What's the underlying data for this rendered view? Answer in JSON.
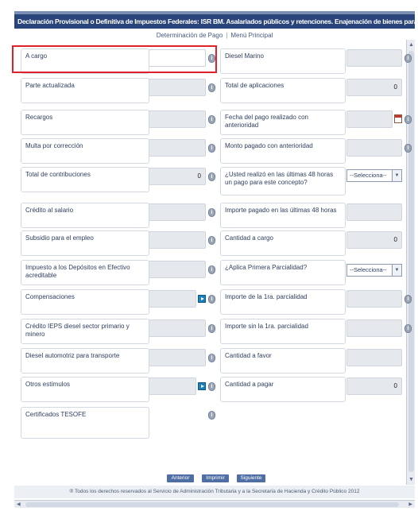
{
  "window": {
    "title": "Declaración Provisional o Definitiva de Impuestos Federales: ISR BM. Asalariados públicos y retenciones. Enajenación de bienes para la Federación"
  },
  "nav_links": {
    "determinacion": "Determinación de Pago",
    "separator": "|",
    "menu_principal": "Menú Principal"
  },
  "left_fields": [
    {
      "label": "A cargo",
      "value": ""
    },
    {
      "label": "Parte actualizada",
      "value": ""
    },
    {
      "label": "Recargos",
      "value": ""
    },
    {
      "label": "Multa por corrección",
      "value": ""
    },
    {
      "label": "Total de contribuciones",
      "value": "0"
    },
    {
      "label": "Crédito al salario",
      "value": ""
    },
    {
      "label": "Subsidio para el empleo",
      "value": ""
    },
    {
      "label": "Impuesto a los Depósitos en Efectivo acreditable",
      "value": ""
    },
    {
      "label": "Compensaciones",
      "value": ""
    },
    {
      "label": "Crédito IEPS diesel sector primario y minero",
      "value": ""
    },
    {
      "label": "Diesel automotriz para transporte",
      "value": ""
    },
    {
      "label": "Otros estímulos",
      "value": ""
    },
    {
      "label": "Certificados TESOFE",
      "value": ""
    }
  ],
  "right_fields": [
    {
      "label": "Diesel Marino",
      "value": ""
    },
    {
      "label": "Total de aplicaciones",
      "value": "0"
    },
    {
      "label": "Fecha del pago realizado con anterioridad",
      "value": ""
    },
    {
      "label": "Monto pagado con anterioridad",
      "value": ""
    },
    {
      "label": "¿Usted realizó en las últimas 48 horas un pago para este concepto?",
      "select": "--Selecciona--"
    },
    {
      "label": "Importe pagado en las últimas 48 horas",
      "value": ""
    },
    {
      "label": "Cantidad a cargo",
      "value": "0"
    },
    {
      "label": "¿Aplica Primera Parcialidad?",
      "select": "--Selecciona--"
    },
    {
      "label": "Importe de la 1ra. parcialidad",
      "value": ""
    },
    {
      "label": "Importe sin la 1ra. parcialidad",
      "value": ""
    },
    {
      "label": "Cantidad a favor",
      "value": ""
    },
    {
      "label": "Cantidad a pagar",
      "value": "0"
    }
  ],
  "buttons": {
    "anterior": "Anterior",
    "imprimir": "Imprimir",
    "siguiente": "Siguiente"
  },
  "footer": {
    "text": "® Todos los derechos reservados al Servicio de Administración Tributaria y a la Secretaría de Hacienda y Crédito Público 2012"
  },
  "colors": {
    "titlebar": "#29447a",
    "highlight": "#e0212b",
    "calc_icon": "#1b7fb8"
  },
  "icons": {
    "info": "info-icon",
    "calculator": "calculator-icon",
    "calendar": "calendar-icon"
  }
}
